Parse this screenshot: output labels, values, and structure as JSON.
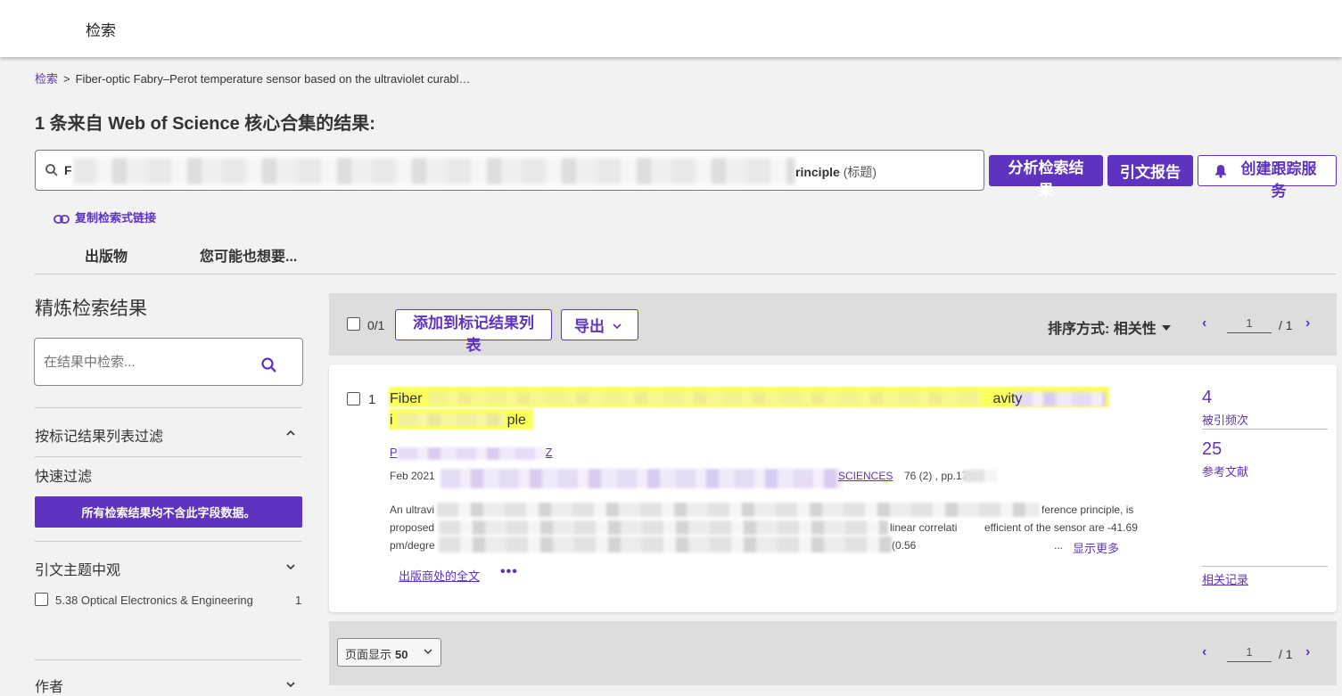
{
  "topbar": {
    "title": "检索"
  },
  "breadcrumb": {
    "root": "检索",
    "separator": ">",
    "current": "Fiber-optic Fabry–Perot temperature sensor based on the ultraviolet curabl…"
  },
  "results_heading": "1 条来自 Web of Science 核心合集的结果:",
  "query": {
    "prefix": "F",
    "suffix": "rinciple",
    "field_tag": "(标题)"
  },
  "actions": {
    "analyze": "分析检索结果",
    "citation_report": "引文报告",
    "create_alert": "创建跟踪服务",
    "copy_link": "复制检索式链接"
  },
  "tabs": [
    "出版物",
    "您可能也想要..."
  ],
  "refine": {
    "title": "精炼检索结果",
    "search_placeholder": "在结果中检索...",
    "marked_list_filter": "按标记结果列表过滤",
    "quick_filter": "快速过滤",
    "no_data_button": "所有检索结果均不含此字段数据。",
    "citation_topics": "引文主题中观",
    "topic_item": {
      "label": "5.38 Optical Electronics & Engineering",
      "count": "1"
    },
    "authors": "作者"
  },
  "toolbar": {
    "selected": "0/1",
    "add_to_list": "添加到标记结果列表",
    "export": "导出",
    "sort_label": "排序方式: 相关性",
    "page_current": "1",
    "page_total": "/ 1"
  },
  "record": {
    "number": "1",
    "title_start": "Fiber",
    "title_mid": "avity",
    "title_line2_start": "i",
    "title_line2_end": "ple",
    "authors_start": "P",
    "authors_end": "Z",
    "pub_date": "Feb 2021",
    "journal_end": "SCIENCES",
    "volume_pages": "76 (2) , pp.175",
    "abstract_l1_start": "An ultravi",
    "abstract_l1_end": "ference principle, is",
    "abstract_l2_start": "proposed",
    "abstract_l2_mid": "linear correlati",
    "abstract_l2_end": "efficient of the sensor are -41.69",
    "abstract_l3_start": "pm/degre",
    "abstract_l3_end": "(0.56",
    "ellipsis": "...",
    "show_more": "显示更多",
    "full_text": "出版商处的全文",
    "more_dots": "•••",
    "times_cited": "4",
    "times_cited_label": "被引频次",
    "references": "25",
    "references_label": "参考文献",
    "related": "相关记录"
  },
  "bottom": {
    "per_page_label": "页面显示",
    "per_page_value": "50",
    "page_current": "1",
    "page_total": "/ 1"
  },
  "colors": {
    "accent": "#5e33bf",
    "highlight": "#fbff5a",
    "toolbar_bg": "#dddddd"
  }
}
